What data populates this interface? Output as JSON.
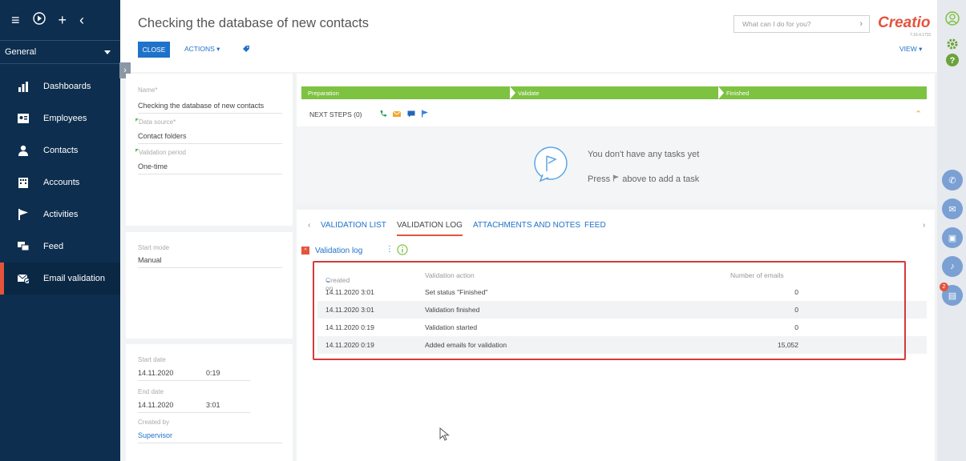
{
  "sidebar": {
    "workplace": "General",
    "items": [
      {
        "label": "Dashboards",
        "icon": "bar-chart-icon"
      },
      {
        "label": "Employees",
        "icon": "employee-card-icon"
      },
      {
        "label": "Contacts",
        "icon": "person-icon"
      },
      {
        "label": "Accounts",
        "icon": "building-icon"
      },
      {
        "label": "Activities",
        "icon": "flag-icon"
      },
      {
        "label": "Feed",
        "icon": "chat-icon"
      },
      {
        "label": "Email validation",
        "icon": "email-check-icon"
      }
    ]
  },
  "header": {
    "title": "Checking the database of new contacts",
    "close_label": "CLOSE",
    "actions_label": "ACTIONS",
    "search_placeholder": "What can I do for you?",
    "logo_text": "Creatio",
    "version": "7.16.4.1731",
    "view_label": "VIEW"
  },
  "details": {
    "name_label": "Name*",
    "name_value": "Checking the database of new contacts",
    "source_label": "Data source*",
    "source_value": "Contact folders",
    "period_label": "Validation period",
    "period_value": "One-time",
    "start_mode_label": "Start mode",
    "start_mode_value": "Manual",
    "start_date_label": "Start date",
    "start_date_value": "14.11.2020",
    "start_time_value": "0:19",
    "end_date_label": "End date",
    "end_date_value": "14.11.2020",
    "end_time_value": "3:01",
    "created_by_label": "Created by",
    "created_by_value": "Supervisor"
  },
  "stages": [
    "Preparation",
    "Validate",
    "Finished"
  ],
  "next_steps": {
    "label": "NEXT STEPS (0)",
    "empty_title": "You don't have any tasks yet",
    "empty_hint_before": "Press",
    "empty_hint_after": "above to add a task"
  },
  "tabs": [
    "VALIDATION LIST",
    "VALIDATION LOG",
    "ATTACHMENTS AND NOTES",
    "FEED"
  ],
  "log": {
    "title": "Validation log",
    "columns": [
      "Created on",
      "Validation action",
      "Number of emails"
    ],
    "rows": [
      {
        "created": "14.11.2020 3:01",
        "action": "Set status \"Finished\"",
        "count": "0"
      },
      {
        "created": "14.11.2020 3:01",
        "action": "Validation finished",
        "count": "0"
      },
      {
        "created": "14.11.2020 0:19",
        "action": "Validation started",
        "count": "0"
      },
      {
        "created": "14.11.2020 0:19",
        "action": "Added emails for validation",
        "count": "15,052"
      }
    ]
  },
  "rail": {
    "notification_count": "2"
  },
  "colors": {
    "sidebar": "#0d2e4e",
    "accent": "#1f72c9",
    "brand": "#e5533d",
    "stage": "#7dc241",
    "highlight": "#d53a3a"
  }
}
